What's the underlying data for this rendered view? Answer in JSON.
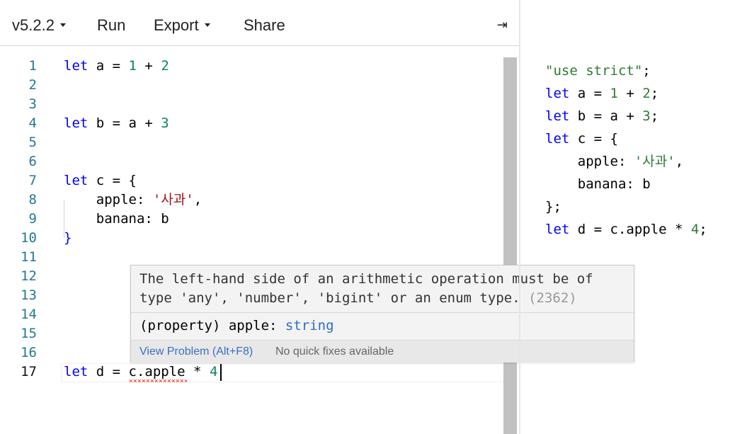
{
  "toolbar": {
    "version": "v5.2.2",
    "run": "Run",
    "export": "Export",
    "share": "Share",
    "collapse_icon": "⇥"
  },
  "editor": {
    "line_numbers": [
      "1",
      "2",
      "3",
      "4",
      "5",
      "6",
      "7",
      "8",
      "9",
      "10",
      "11",
      "12",
      "13",
      "14",
      "15",
      "16",
      "17"
    ],
    "lines": {
      "l1": {
        "kw": "let",
        "rest1": " a = ",
        "n1": "1",
        "op": " + ",
        "n2": "2"
      },
      "l4": {
        "kw": "let",
        "rest1": " b = a + ",
        "n1": "3"
      },
      "l7": {
        "kw": "let",
        "rest1": " c = {"
      },
      "l8": {
        "key": "    apple: ",
        "str": "'사과'",
        "tail": ","
      },
      "l9": {
        "text": "    banana: b"
      },
      "l10": {
        "text": "}"
      },
      "l17": {
        "kw": "let",
        "rest1": " d = ",
        "err": "c.apple",
        "op": " * ",
        "n1": "4"
      }
    }
  },
  "hover": {
    "message": "The left-hand side of an arithmetic operation must be of type 'any', 'number', 'bigint' or an enum type.",
    "code": "(2362)",
    "type_prefix": "(property) apple: ",
    "type_name": "string",
    "view_problem": "View Problem (Alt+F8)",
    "no_fixes": "No quick fixes available"
  },
  "output": {
    "l1": "\"use strict\"",
    "l1_tail": ";",
    "l2_kw": "let",
    "l2_a": " a = ",
    "l2_n1": "1",
    "l2_op": " + ",
    "l2_n2": "2",
    "l2_tail": ";",
    "l3_kw": "let",
    "l3_a": " b = a + ",
    "l3_n1": "3",
    "l3_tail": ";",
    "l4_kw": "let",
    "l4_a": " c = {",
    "l5_key": "    apple: ",
    "l5_str": "'사과'",
    "l5_tail": ",",
    "l6": "    banana: b",
    "l7": "};",
    "l8_kw": "let",
    "l8_a": " d = c.apple * ",
    "l8_n1": "4",
    "l8_tail": ";"
  },
  "colors": {
    "keyword": "#0000ff",
    "number": "#098658",
    "string": "#a31515",
    "line_number": "#237893",
    "error": "#e51400"
  }
}
